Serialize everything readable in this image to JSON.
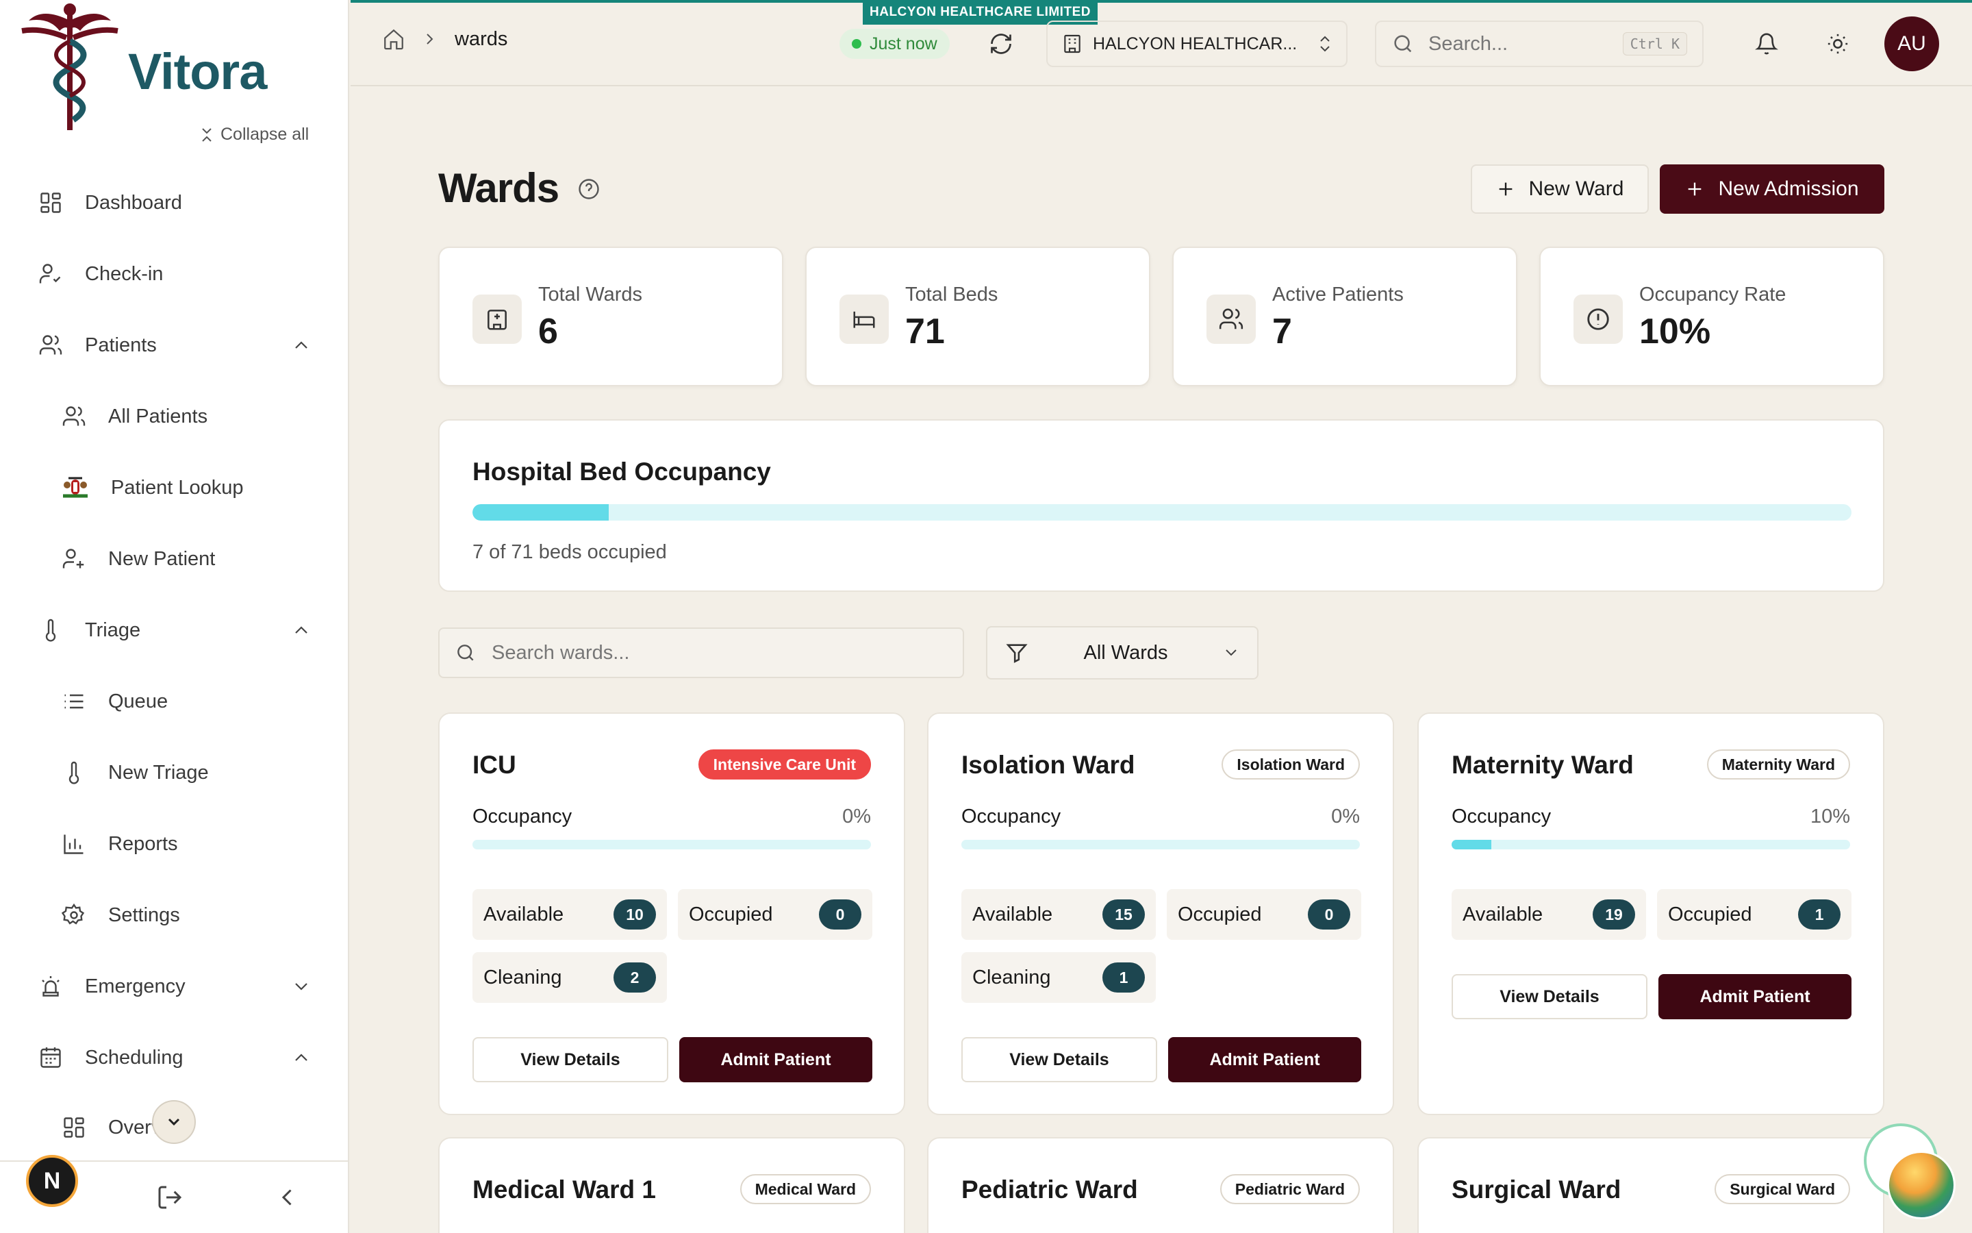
{
  "app": {
    "logo_text": "Vitora",
    "org_tag": "HALCYON HEALTHCARE LIMITED"
  },
  "sidebar": {
    "collapse_label": "Collapse all",
    "items": [
      {
        "label": "Dashboard",
        "icon": "dashboard-icon"
      },
      {
        "label": "Check-in",
        "icon": "user-check-icon"
      },
      {
        "label": "Patients",
        "icon": "users-icon",
        "expanded": true
      },
      {
        "label": "All Patients",
        "icon": "users-icon"
      },
      {
        "label": "Patient Lookup",
        "icon": "kenya-emblem-icon"
      },
      {
        "label": "New Patient",
        "icon": "user-plus-icon"
      },
      {
        "label": "Triage",
        "icon": "thermometer-icon",
        "expanded": true
      },
      {
        "label": "Queue",
        "icon": "list-icon"
      },
      {
        "label": "New Triage",
        "icon": "thermometer-icon"
      },
      {
        "label": "Reports",
        "icon": "bar-chart-icon"
      },
      {
        "label": "Settings",
        "icon": "gear-icon"
      },
      {
        "label": "Emergency",
        "icon": "siren-icon",
        "expanded": false
      },
      {
        "label": "Scheduling",
        "icon": "calendar-icon",
        "expanded": true
      },
      {
        "label": "Overview",
        "icon": "dashboard-icon"
      }
    ],
    "footer_avatar": "N"
  },
  "topbar": {
    "breadcrumb_current": "wards",
    "status_label": "Just now",
    "org_name": "HALCYON HEALTHCAR...",
    "search_placeholder": "Search...",
    "search_shortcut": "Ctrl K",
    "user_initials": "AU"
  },
  "page": {
    "title": "Wards",
    "new_ward_label": "New Ward",
    "new_admission_label": "New Admission"
  },
  "stats": [
    {
      "label": "Total Wards",
      "value": "6",
      "icon": "hospital-icon"
    },
    {
      "label": "Total Beds",
      "value": "71",
      "icon": "bed-icon"
    },
    {
      "label": "Active Patients",
      "value": "7",
      "icon": "users-icon"
    },
    {
      "label": "Occupancy Rate",
      "value": "10%",
      "icon": "alert-circle-icon"
    }
  ],
  "occupancy": {
    "title": "Hospital Bed Occupancy",
    "summary": "7 of 71 beds occupied",
    "fraction": 0.0986
  },
  "filters": {
    "search_placeholder": "Search wards...",
    "type_selected": "All Wards"
  },
  "labels": {
    "occupancy": "Occupancy",
    "available": "Available",
    "occupied": "Occupied",
    "cleaning": "Cleaning",
    "view_details": "View Details",
    "admit_patient": "Admit Patient"
  },
  "wards": [
    {
      "name": "ICU",
      "badge": "Intensive Care Unit",
      "occupancy": "0%",
      "available": "10",
      "occupied": "0",
      "cleaning": "2"
    },
    {
      "name": "Isolation Ward",
      "badge": "Isolation Ward",
      "occupancy": "0%",
      "available": "15",
      "occupied": "0",
      "cleaning": "1"
    },
    {
      "name": "Maternity Ward",
      "badge": "Maternity Ward",
      "occupancy": "10%",
      "available": "19",
      "occupied": "1"
    },
    {
      "name": "Medical Ward 1",
      "badge": "Medical Ward"
    },
    {
      "name": "Pediatric Ward",
      "badge": "Pediatric Ward"
    },
    {
      "name": "Surgical Ward",
      "badge": "Surgical Ward"
    }
  ],
  "colors": {
    "brand": "#4a0b16",
    "accent_teal": "#15857a",
    "progress_fill": "#62dbe8",
    "progress_track": "#dcf6f8",
    "count_pill": "#1d4650",
    "icu_badge": "#ee4646"
  }
}
